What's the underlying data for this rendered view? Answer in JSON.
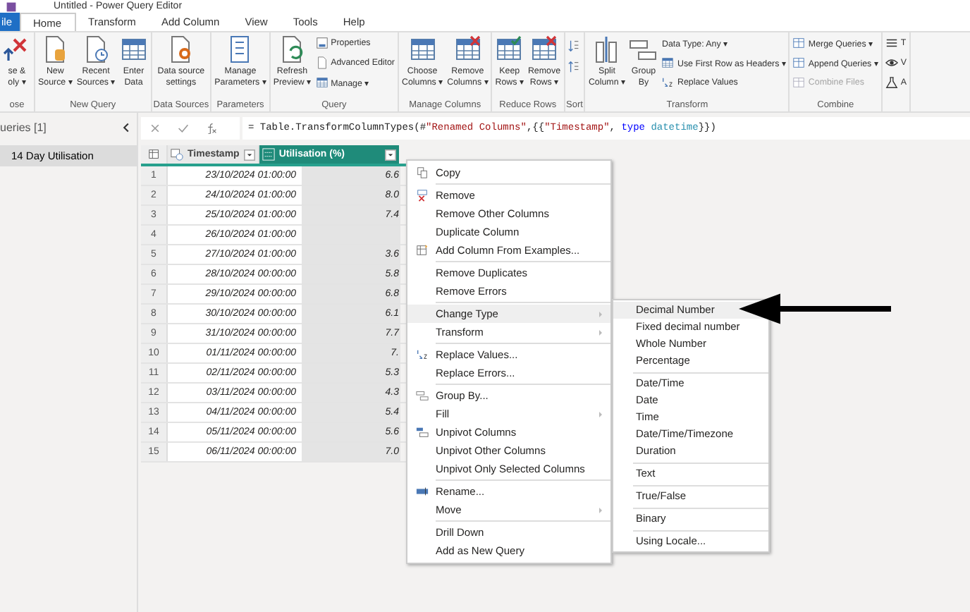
{
  "window": {
    "title": "Untitled - Power Query Editor"
  },
  "tabs": [
    {
      "label": "ile",
      "kind": "file",
      "selected": false
    },
    {
      "label": "Home",
      "kind": "tab",
      "selected": true
    },
    {
      "label": "Transform",
      "kind": "tab",
      "selected": false
    },
    {
      "label": "Add Column",
      "kind": "tab",
      "selected": false
    },
    {
      "label": "View",
      "kind": "tab",
      "selected": false
    },
    {
      "label": "Tools",
      "kind": "tab",
      "selected": false
    },
    {
      "label": "Help",
      "kind": "tab",
      "selected": false
    }
  ],
  "ribbon": [
    {
      "label": "ose",
      "kind": "buttons",
      "items": [
        {
          "kind": "large",
          "lines": [
            "se &",
            "oly ▾"
          ],
          "disabled": false
        }
      ]
    },
    {
      "label": "New Query",
      "kind": "buttons",
      "items": [
        {
          "kind": "large",
          "lines": [
            "New",
            "Source ▾"
          ],
          "disabled": false
        },
        {
          "kind": "large",
          "lines": [
            "Recent",
            "Sources ▾"
          ],
          "disabled": false
        },
        {
          "kind": "large",
          "lines": [
            "Enter",
            "Data"
          ],
          "disabled": false
        }
      ]
    },
    {
      "label": "Data Sources",
      "kind": "buttons",
      "items": [
        {
          "kind": "large",
          "lines": [
            "Data source",
            "settings"
          ],
          "disabled": false
        }
      ]
    },
    {
      "label": "Parameters",
      "kind": "buttons",
      "items": [
        {
          "kind": "large",
          "lines": [
            "Manage",
            "Parameters ▾"
          ],
          "disabled": false
        }
      ]
    },
    {
      "label": "Query",
      "kind": "buttons",
      "items": [
        {
          "kind": "large",
          "lines": [
            "Refresh",
            "Preview ▾"
          ],
          "disabled": false
        },
        {
          "kind": "small",
          "lines": [
            "Properties"
          ],
          "disabled": false
        },
        {
          "kind": "small",
          "lines": [
            "Advanced Editor"
          ],
          "disabled": false
        },
        {
          "kind": "small",
          "lines": [
            "Manage ▾"
          ],
          "disabled": false
        }
      ]
    },
    {
      "label": "Manage Columns",
      "kind": "buttons",
      "items": [
        {
          "kind": "large",
          "lines": [
            "Choose",
            "Columns ▾"
          ],
          "disabled": false
        },
        {
          "kind": "large",
          "lines": [
            "Remove",
            "Columns ▾"
          ],
          "disabled": false
        }
      ]
    },
    {
      "label": "Reduce Rows",
      "kind": "buttons",
      "items": [
        {
          "kind": "large",
          "lines": [
            "Keep",
            "Rows ▾"
          ],
          "disabled": false
        },
        {
          "kind": "large",
          "lines": [
            "Remove",
            "Rows ▾"
          ],
          "disabled": false
        }
      ]
    },
    {
      "label": "Sort",
      "kind": "sort"
    },
    {
      "label": "Transform",
      "kind": "buttons",
      "items": [
        {
          "kind": "large",
          "lines": [
            "Split",
            "Column ▾"
          ],
          "disabled": false
        },
        {
          "kind": "large",
          "lines": [
            "Group",
            "By"
          ],
          "disabled": false
        },
        {
          "kind": "small",
          "lines": [
            "Data Type: Any ▾"
          ],
          "disabled": false
        },
        {
          "kind": "small",
          "lines": [
            "Use First Row as Headers ▾"
          ],
          "disabled": false
        },
        {
          "kind": "small",
          "lines": [
            "Replace Values"
          ],
          "disabled": false
        }
      ]
    },
    {
      "label": "Combine",
      "kind": "buttons",
      "items": [
        {
          "kind": "small",
          "lines": [
            "Merge Queries ▾"
          ],
          "disabled": false
        },
        {
          "kind": "small",
          "lines": [
            "Append Queries ▾"
          ],
          "disabled": false
        },
        {
          "kind": "small",
          "lines": [
            "Combine Files"
          ],
          "disabled": true
        }
      ]
    },
    {
      "kind": "buttons",
      "items": [
        {
          "kind": "small",
          "lines": [
            "T"
          ]
        },
        {
          "kind": "small",
          "lines": [
            "V"
          ]
        },
        {
          "kind": "small",
          "lines": [
            "A"
          ]
        }
      ]
    }
  ],
  "queries": {
    "title": "ueries [1]",
    "items": [
      {
        "label": "14 Day Utilisation",
        "selected": true
      }
    ]
  },
  "formula": [
    {
      "kind": "plain",
      "text": "= Table.TransformColumnTypes(#"
    },
    {
      "kind": "string",
      "text": "\"Renamed Columns\""
    },
    {
      "kind": "plain",
      "text": ",{{"
    },
    {
      "kind": "string",
      "text": "\"Timestamp\""
    },
    {
      "kind": "plain",
      "text": ", "
    },
    {
      "kind": "keyword",
      "text": "type"
    },
    {
      "kind": "type",
      "text": " datetime"
    },
    {
      "kind": "plain",
      "text": "}})"
    }
  ],
  "table": {
    "columns": [
      {
        "name": "Timestamp",
        "kind": "datetime",
        "selected": false
      },
      {
        "name": "Utilisation (%)",
        "kind": "any",
        "selected": true
      }
    ],
    "rows": [
      {
        "n": "1",
        "timestamp": "23/10/2024 01:00:00",
        "utilisation": "6.6"
      },
      {
        "n": "2",
        "timestamp": "24/10/2024 01:00:00",
        "utilisation": "8.0"
      },
      {
        "n": "3",
        "timestamp": "25/10/2024 01:00:00",
        "utilisation": "7.4"
      },
      {
        "n": "4",
        "timestamp": "26/10/2024 01:00:00"
      },
      {
        "n": "5",
        "timestamp": "27/10/2024 01:00:00",
        "utilisation": "3.6"
      },
      {
        "n": "6",
        "timestamp": "28/10/2024 00:00:00",
        "utilisation": "5.8"
      },
      {
        "n": "7",
        "timestamp": "29/10/2024 00:00:00",
        "utilisation": "6.8"
      },
      {
        "n": "8",
        "timestamp": "30/10/2024 00:00:00",
        "utilisation": "6.1"
      },
      {
        "n": "9",
        "timestamp": "31/10/2024 00:00:00",
        "utilisation": "7.7"
      },
      {
        "n": "10",
        "timestamp": "01/11/2024 00:00:00",
        "utilisation": "7."
      },
      {
        "n": "11",
        "timestamp": "02/11/2024 00:00:00",
        "utilisation": "5.3"
      },
      {
        "n": "12",
        "timestamp": "03/11/2024 00:00:00",
        "utilisation": "4.3"
      },
      {
        "n": "13",
        "timestamp": "04/11/2024 00:00:00",
        "utilisation": "5.4"
      },
      {
        "n": "14",
        "timestamp": "05/11/2024 00:00:00",
        "utilisation": "5.6"
      },
      {
        "n": "15",
        "timestamp": "06/11/2024 00:00:00",
        "utilisation": "7.0"
      }
    ]
  },
  "context_menu": [
    [
      {
        "label": "Copy",
        "submenu": false,
        "selected": false
      }
    ],
    [
      {
        "label": "Remove",
        "submenu": false,
        "selected": false
      },
      {
        "label": "Remove Other Columns",
        "submenu": false,
        "selected": false
      },
      {
        "label": "Duplicate Column",
        "submenu": false,
        "selected": false
      },
      {
        "label": "Add Column From Examples...",
        "submenu": false,
        "selected": false
      }
    ],
    [
      {
        "label": "Remove Duplicates",
        "submenu": false,
        "selected": false
      },
      {
        "label": "Remove Errors",
        "submenu": false,
        "selected": false
      }
    ],
    [
      {
        "label": "Change Type",
        "submenu": true,
        "selected": true
      },
      {
        "label": "Transform",
        "submenu": true,
        "selected": false
      }
    ],
    [
      {
        "label": "Replace Values...",
        "submenu": false,
        "selected": false
      },
      {
        "label": "Replace Errors...",
        "submenu": false,
        "selected": false
      }
    ],
    [
      {
        "label": "Group By...",
        "submenu": false,
        "selected": false
      },
      {
        "label": "Fill",
        "submenu": true,
        "selected": false
      },
      {
        "label": "Unpivot Columns",
        "submenu": false,
        "selected": false
      },
      {
        "label": "Unpivot Other Columns",
        "submenu": false,
        "selected": false
      },
      {
        "label": "Unpivot Only Selected Columns",
        "submenu": false,
        "selected": false
      }
    ],
    [
      {
        "label": "Rename...",
        "submenu": false,
        "selected": false
      },
      {
        "label": "Move",
        "submenu": true,
        "selected": false
      }
    ],
    [
      {
        "label": "Drill Down",
        "submenu": false,
        "selected": false
      },
      {
        "label": "Add as New Query",
        "submenu": false,
        "selected": false
      }
    ]
  ],
  "submenu": [
    [
      {
        "label": "Decimal Number",
        "selected": true
      },
      {
        "label": "Fixed decimal number",
        "selected": false
      },
      {
        "label": "Whole Number",
        "selected": false
      },
      {
        "label": "Percentage",
        "selected": false
      }
    ],
    [
      {
        "label": "Date/Time",
        "selected": false
      },
      {
        "label": "Date",
        "selected": false
      },
      {
        "label": "Time",
        "selected": false
      },
      {
        "label": "Date/Time/Timezone",
        "selected": false
      },
      {
        "label": "Duration",
        "selected": false
      }
    ],
    [
      {
        "label": "Text",
        "selected": false
      }
    ],
    [
      {
        "label": "True/False",
        "selected": false
      }
    ],
    [
      {
        "label": "Binary",
        "selected": false
      }
    ],
    [
      {
        "label": "Using Locale...",
        "selected": false
      }
    ]
  ]
}
